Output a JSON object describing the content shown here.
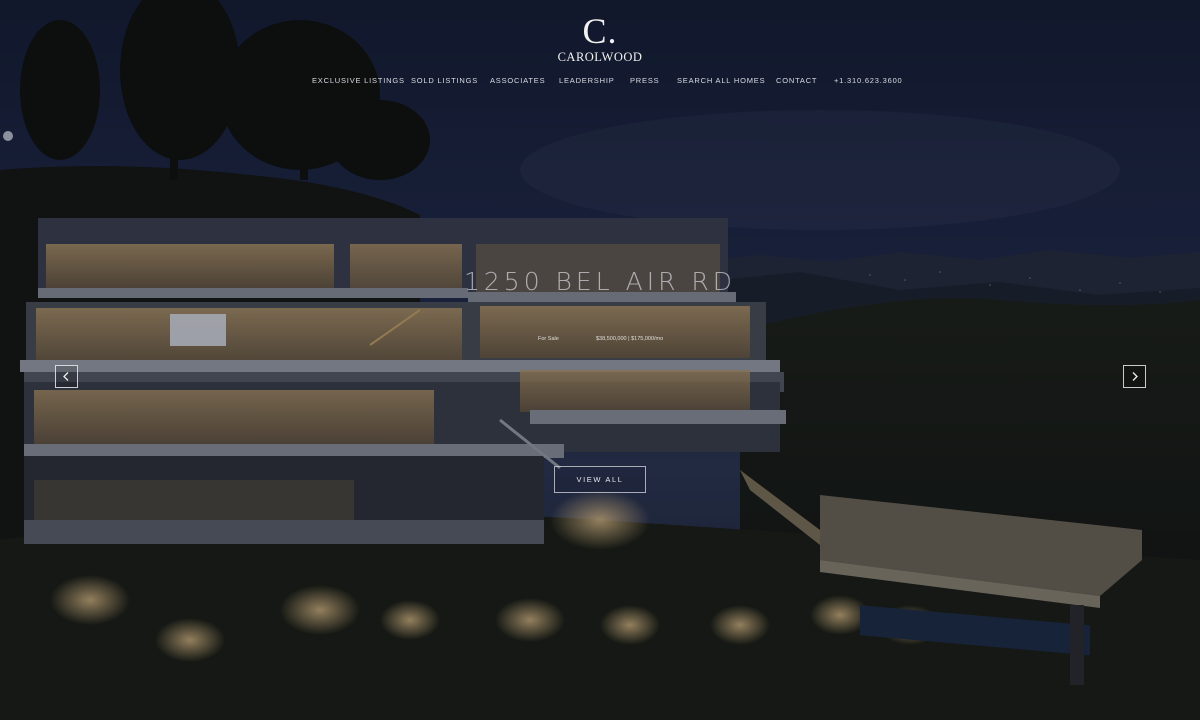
{
  "site": {
    "logo_mark": "C.",
    "logo_word": "CAROLWOOD"
  },
  "nav": {
    "items": [
      {
        "label": "EXCLUSIVE LISTINGS"
      },
      {
        "label": "SOLD LISTINGS"
      },
      {
        "label": "ASSOCIATES"
      },
      {
        "label": "LEADERSHIP"
      },
      {
        "label": "PRESS"
      },
      {
        "label": "SEARCH ALL HOMES"
      },
      {
        "label": "CONTACT"
      },
      {
        "label": "+1.310.623.3600"
      }
    ]
  },
  "listing": {
    "title": "1250 BEL AIR RD",
    "status": "For Sale",
    "price": "$38,500,000 | $175,000/mo",
    "cta": "VIEW ALL"
  },
  "carousel": {
    "prev_icon": "chevron-left-icon",
    "next_icon": "chevron-right-icon"
  },
  "colors": {
    "sky": "#1e2746",
    "overlay": "#0b0f1a",
    "text": "#f1f1f1",
    "window_glow": "#c9a46b"
  }
}
